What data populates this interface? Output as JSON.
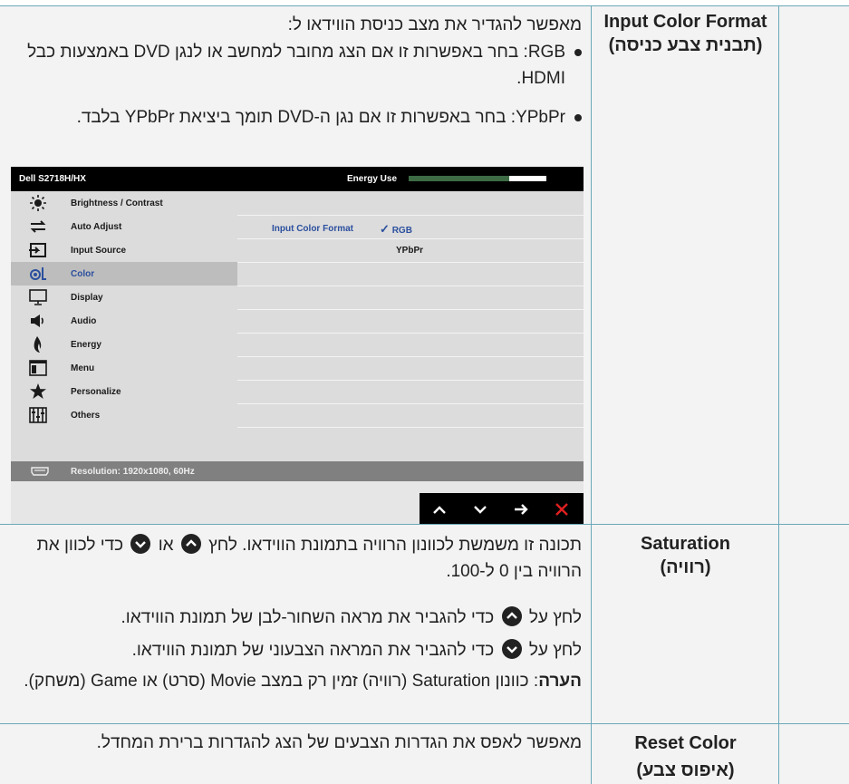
{
  "rows": [
    {
      "label_en": "Input Color Format",
      "label_he": "(תבנית צבע כניסה)",
      "intro": "מאפשר להגדיר את מצב כניסת הווידאו ל:",
      "bullets": [
        {
          "key": "RGB",
          "text": ": בחר באפשרות זו אם הצג מחובר למחשב או לנגן DVD באמצעות כבל HDMI."
        },
        {
          "key": "YPbPr",
          "text": ": בחר באפשרות זו אם נגן ה-DVD תומך ביציאת YPbPr בלבד."
        }
      ]
    },
    {
      "label_en": "Saturation",
      "label_he": "(רוויה)",
      "p1a": "תכונה זו משמשת לכוונון הרוויה בתמונת הווידאו. לחץ",
      "p1b": "או",
      "p1c": "כדי לכוון את הרוויה בין 0 ל-100.",
      "p2a": "לחץ על",
      "p2b": "כדי להגביר את מראה השחור-לבן של תמונת הווידאו.",
      "p3a": "לחץ על",
      "p3b": "כדי להגביר את המראה הצבעוני של תמונת הווידאו.",
      "note_label": "הערה",
      "note_text": ": כוונון Saturation (רוויה) זמין רק במצב Movie (סרט) או Game (משחק)."
    },
    {
      "label_en": "Reset Color",
      "label_he": "(איפוס צבע)",
      "text": "מאפשר לאפס את הגדרות הצבעים של הצג להגדרות ברירת המחדל."
    }
  ],
  "osd": {
    "model": "Dell S2718H/HX",
    "energy_label": "Energy Use",
    "energy_level": 0.6,
    "menu": [
      {
        "label": "Brightness / Contrast",
        "icon": "brightness-icon"
      },
      {
        "label": "Auto Adjust",
        "icon": "auto-adjust-icon"
      },
      {
        "label": "Input Source",
        "icon": "input-source-icon"
      },
      {
        "label": "Color",
        "icon": "color-icon",
        "selected": true
      },
      {
        "label": "Display",
        "icon": "display-icon"
      },
      {
        "label": "Audio",
        "icon": "audio-icon"
      },
      {
        "label": "Energy",
        "icon": "energy-icon"
      },
      {
        "label": "Menu",
        "icon": "menu-icon"
      },
      {
        "label": "Personalize",
        "icon": "star-icon"
      },
      {
        "label": "Others",
        "icon": "others-icon"
      }
    ],
    "option_label": "Input Color Format",
    "options": [
      "RGB",
      "YPbPr"
    ],
    "selected_option": "RGB",
    "resolution": "Resolution: 1920x1080, 60Hz",
    "nav": [
      "up-arrow-icon",
      "down-arrow-icon",
      "right-arrow-icon",
      "close-icon"
    ],
    "colors": {
      "accent": "#2b4f9e",
      "energy": "#3d6b44",
      "close": "#e02020"
    }
  }
}
